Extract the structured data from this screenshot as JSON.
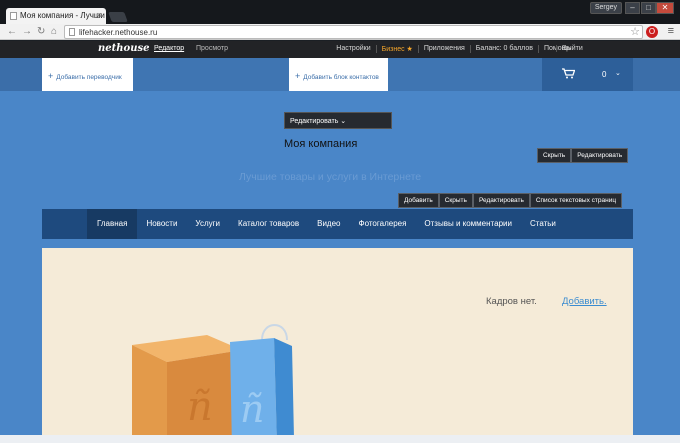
{
  "browser": {
    "tab_title": "Моя компания - Лучши",
    "tab_close": "×",
    "user": "Sergey",
    "win_min": "–",
    "win_max": "□",
    "win_close": "✕",
    "url": "lifehacker.nethouse.ru"
  },
  "topbar": {
    "logo": "nethouse",
    "editor": "Редактор",
    "preview": "Просмотр",
    "settings": "Настройки",
    "business": "Бизнес ★",
    "apps": "Приложения",
    "balance": "Баланс: 0 баллов",
    "help": "Помощь",
    "exit": "Выйти"
  },
  "header": {
    "add_translator": "Добавить переводчик",
    "add_contacts": "Добавить блок контактов",
    "cart_count": "0"
  },
  "company": {
    "edit_dropdown": "Редактировать ⌄",
    "name": "Моя компания",
    "hide": "Скрыть",
    "edit": "Редактировать",
    "slogan": "Лучшие товары и услуги в Интернете"
  },
  "slogan_buttons": {
    "add": "Добавить",
    "hide": "Скрыть",
    "edit": "Редактировать",
    "pages": "Список текстовых страниц"
  },
  "nav": [
    "Главная",
    "Новости",
    "Услуги",
    "Каталог товаров",
    "Видео",
    "Фотогалерея",
    "Отзывы и комментарии",
    "Статьи"
  ],
  "gallery": {
    "empty": "Кадров нет.",
    "add": "Добавить."
  },
  "colors": {
    "page_bg": "#4a86c8",
    "nav_bg": "#1e4a7e",
    "business": "#f4a52a",
    "content_bg": "#f5ebd8"
  }
}
